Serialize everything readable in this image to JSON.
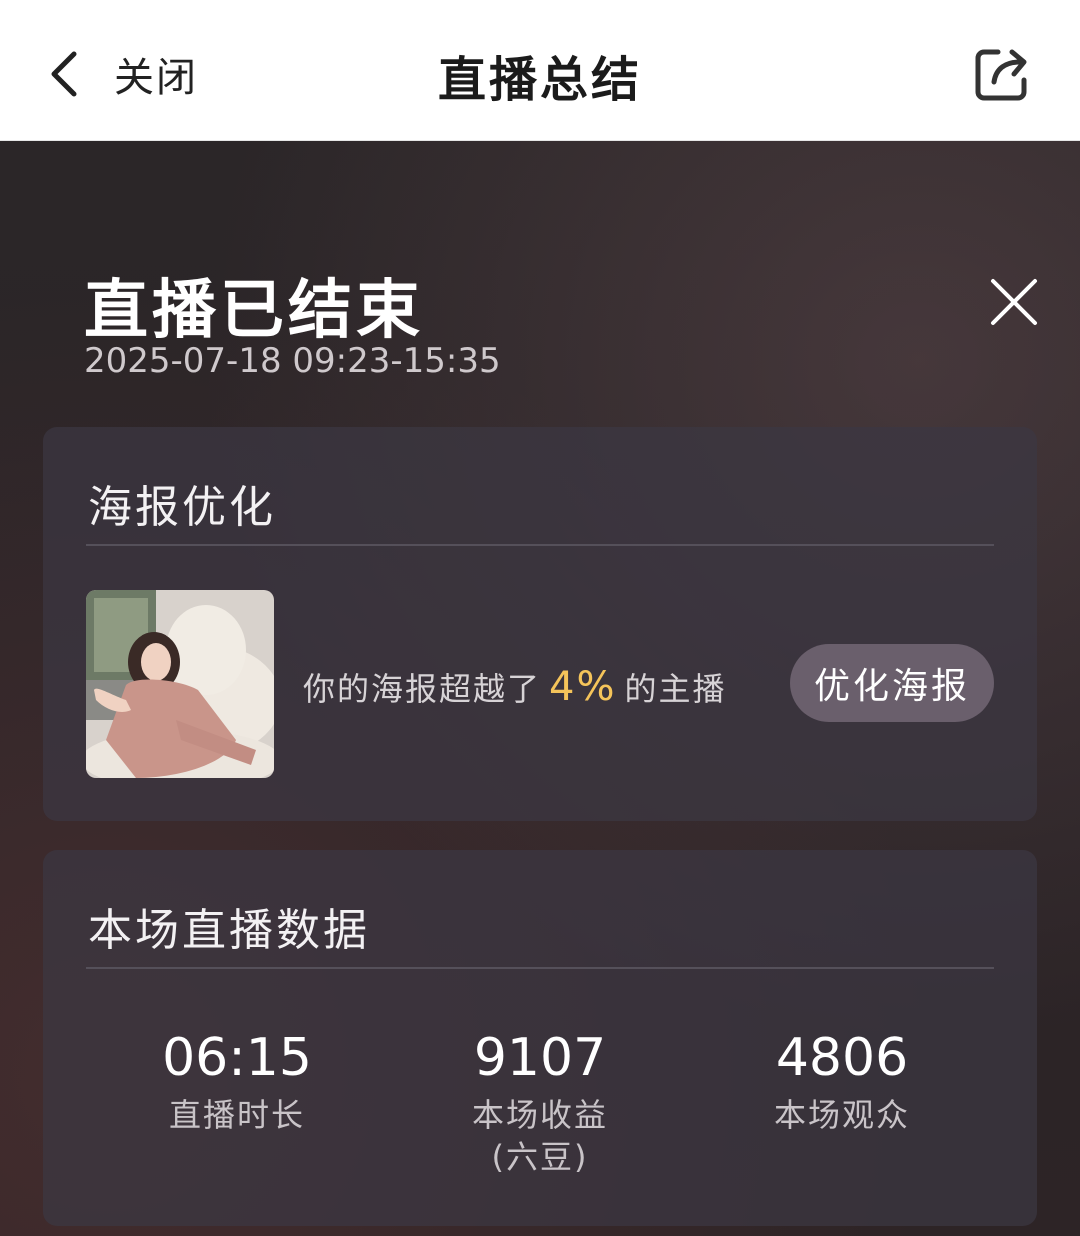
{
  "nav": {
    "back_label": "关闭",
    "title": "直播总结"
  },
  "summary": {
    "title": "直播已结束",
    "time_range": "2025-07-18 09:23-15:35"
  },
  "poster": {
    "section_title": "海报优化",
    "text_prefix": "你的海报超越了",
    "percent": "4%",
    "text_suffix": "的主播",
    "button_label": "优化海报"
  },
  "stats": {
    "section_title": "本场直播数据",
    "items": [
      {
        "value": "06:15",
        "label": "直播时长",
        "sublabel": ""
      },
      {
        "value": "9107",
        "label": "本场收益",
        "sublabel": "(六豆)"
      },
      {
        "value": "4806",
        "label": "本场观众",
        "sublabel": ""
      }
    ]
  },
  "colors": {
    "accent_percent": "#f5c45a",
    "button_bg": "#6a5f6c",
    "card_bg": "#3c3842"
  }
}
